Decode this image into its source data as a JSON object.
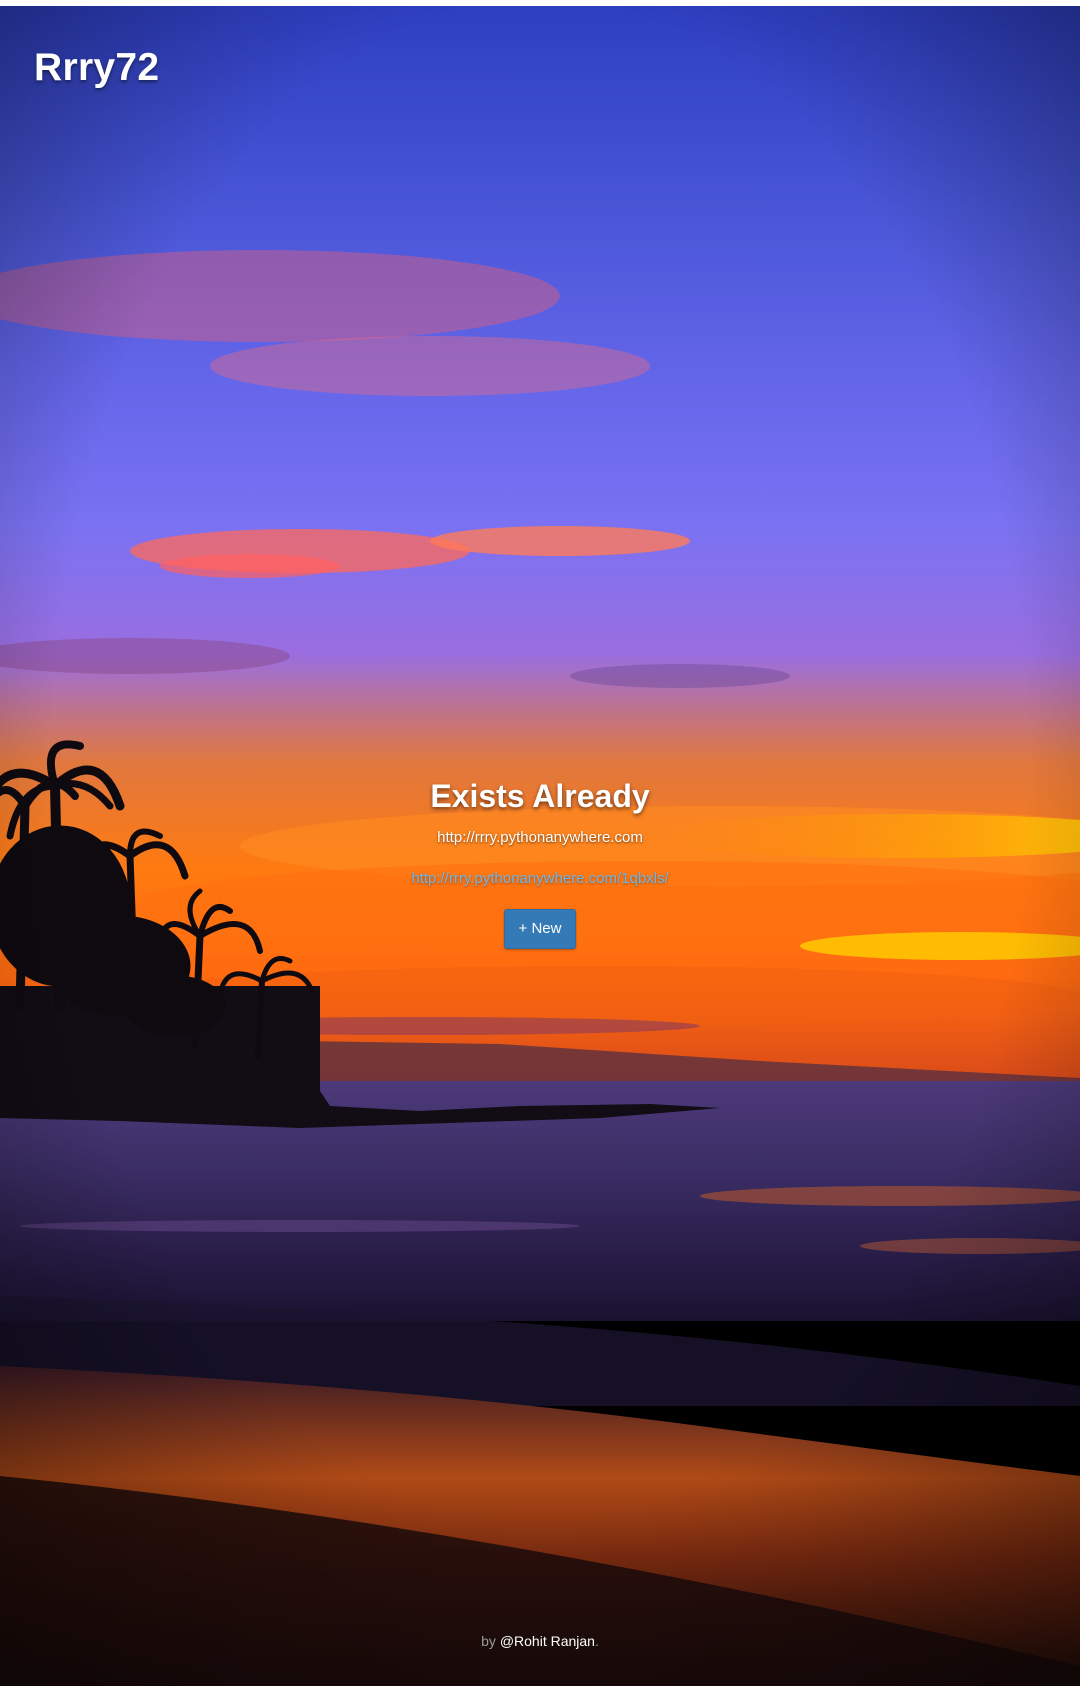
{
  "header": {
    "brand": "Rrry72"
  },
  "main": {
    "heading": "Exists Already",
    "site_url": "http://rrry.pythonanywhere.com",
    "short_link": "http://rrry.pythonanywhere.com/1qbxls/",
    "new_button_label": "+ New"
  },
  "footer": {
    "prefix": "by",
    "author": "@Rohit Ranjan",
    "suffix": "."
  },
  "colors": {
    "button": "#337ab7",
    "link": "#6fb6e8",
    "text": "#ffffff"
  }
}
